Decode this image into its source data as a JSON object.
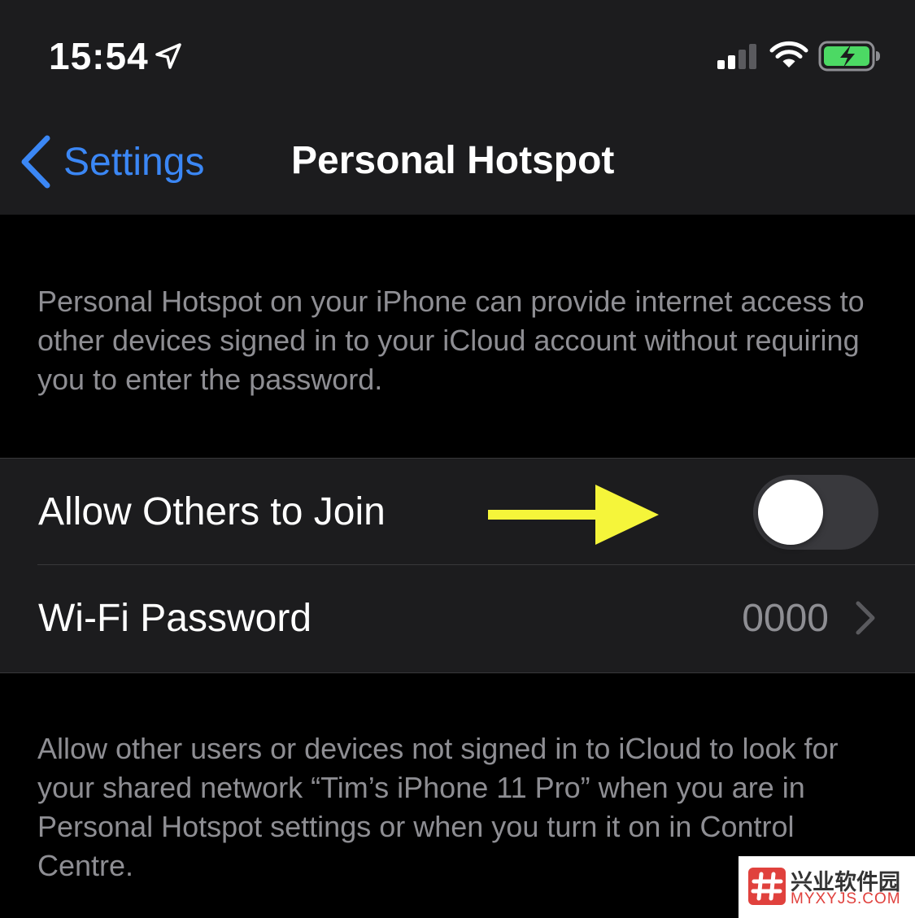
{
  "status_bar": {
    "time": "15:54",
    "icons": [
      "location-arrow-icon",
      "cellular-signal-icon",
      "wifi-icon",
      "battery-charging-icon"
    ]
  },
  "nav": {
    "back_label": "Settings",
    "title": "Personal Hotspot"
  },
  "description_top": "Personal Hotspot on your iPhone can provide internet access to other devices signed in to your iCloud account without requiring you to enter the password.",
  "rows": {
    "allow_others": {
      "label": "Allow Others to Join",
      "toggle_on": false
    },
    "wifi_password": {
      "label": "Wi-Fi Password",
      "value": "0000"
    }
  },
  "description_bottom": "Allow other users or devices not signed in to iCloud to look for your shared network “Tim’s iPhone 11 Pro” when you are in Personal Hotspot settings or when you turn it on in Control Centre.",
  "watermark": {
    "cn": "兴业软件园",
    "en": "MYXYJS.COM"
  },
  "colors": {
    "accent": "#3b87f5",
    "background": "#000000",
    "cell": "#1c1c1e",
    "secondary_text": "#8e8e93",
    "annotation_arrow": "#f5f53a",
    "battery_green": "#4cd964"
  }
}
